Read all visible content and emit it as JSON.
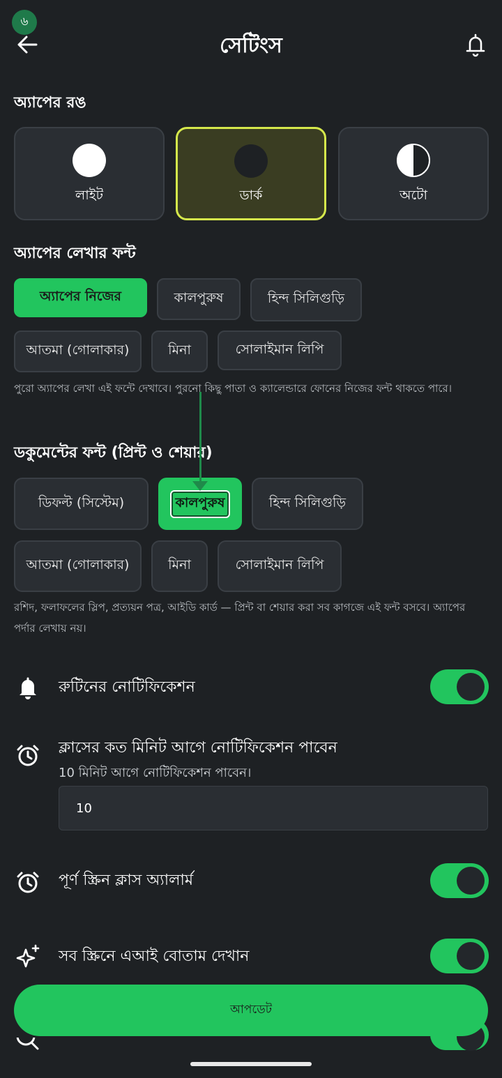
{
  "status": {
    "badge": "৬"
  },
  "header": {
    "title": "সেটিংস"
  },
  "theme": {
    "title": "অ্যাপের রঙ",
    "options": [
      {
        "label": "লাইট",
        "icon": "light-theme-circle-icon"
      },
      {
        "label": "ডার্ক",
        "icon": "dark-theme-circle-icon"
      },
      {
        "label": "অটো",
        "icon": "auto-theme-half-circle-icon"
      }
    ],
    "selected": "ডার্ক",
    "accent": "#d5e84b"
  },
  "app_font": {
    "title": "অ্যাপের লেখার ফন্ট",
    "options": [
      "অ্যাপের নিজের",
      "কালপুরুষ",
      "হিন্দ সিলিগুড়ি",
      "আতমা (গোলাকার)",
      "মিনা",
      "সোলাইমান লিপি"
    ],
    "selected": "অ্যাপের নিজের",
    "help": "পুরো অ্যাপের লেখা এই ফন্টে দেখাবে। পুরনো কিছু পাতা ও ক্যালেন্ডারে ফোনের নিজের ফন্ট থাকতে পারে।"
  },
  "doc_font": {
    "title": "ডকুমেন্টের ফন্ট (প্রিন্ট ও শেয়ার)",
    "options": [
      "ডিফল্ট (সিস্টেম)",
      "কালপুরুষ",
      "হিন্দ সিলিগুড়ি",
      "আতমা (গোলাকার)",
      "মিনা",
      "সোলাইমান লিপি"
    ],
    "selected": "কালপুরুষ",
    "help": "রশিদ, ফলাফলের স্লিপ, প্রত্যয়ন পত্র, আইডি কার্ড — প্রিন্ট বা শেয়ার করা সব কাগজে এই ফন্ট বসবে। অ্যাপের পর্দার লেখায় নয়।"
  },
  "settings": {
    "routine_notification": {
      "label": "রুটিনের নোটিফিকেশন",
      "enabled": true
    },
    "notify_before": {
      "label": "ক্লাসের কত মিনিট আগে নোটিফিকেশন পাবেন",
      "sub": "10 মিনিট আগে নোটিফিকেশন পাবেন।",
      "value": "10"
    },
    "fullscreen_alarm": {
      "label": "পূর্ণ স্ক্রিন ক্লাস অ্যালার্ম",
      "enabled": true
    },
    "ai_button": {
      "label": "সব স্ক্রিনে এআই বোতাম দেখান",
      "enabled": true
    }
  },
  "actions": {
    "update": "আপডেট"
  },
  "colors": {
    "background": "#1e2124",
    "primary": "#22c55e",
    "card": "#2a2e33"
  }
}
